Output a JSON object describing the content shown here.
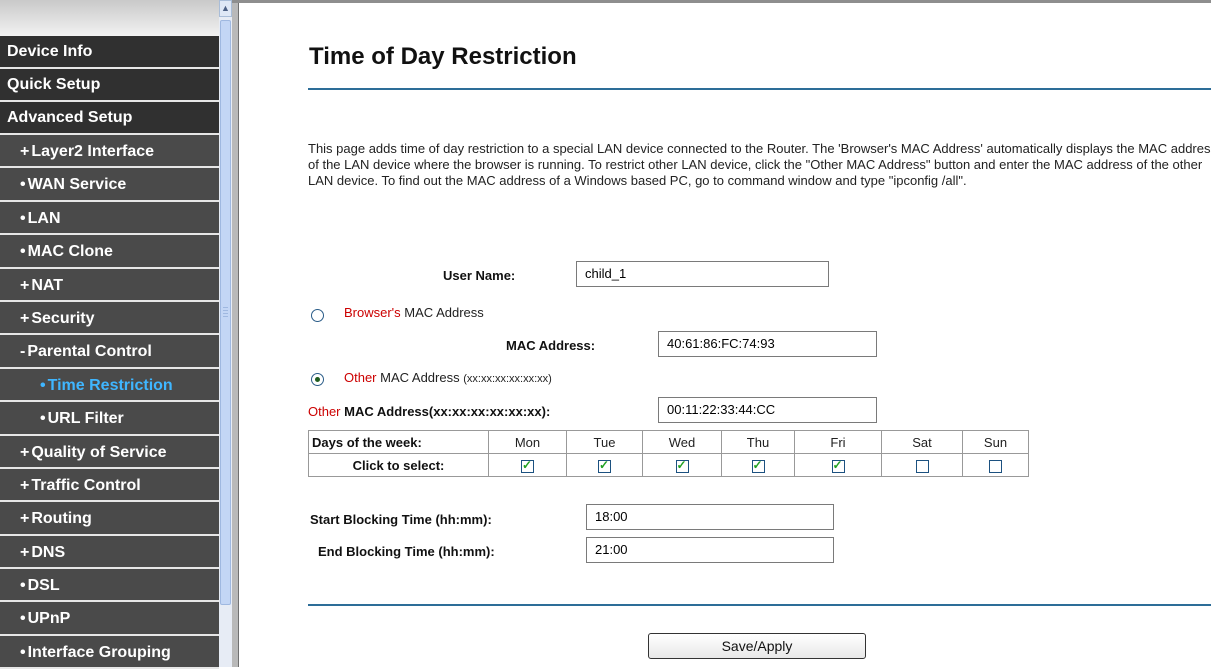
{
  "sidebar": {
    "items": [
      {
        "label": "Device Info",
        "level": 0,
        "marker": ""
      },
      {
        "label": "Quick Setup",
        "level": 0,
        "marker": ""
      },
      {
        "label": "Advanced Setup",
        "level": 0,
        "marker": ""
      },
      {
        "label": "Layer2 Interface",
        "level": 1,
        "marker": "+"
      },
      {
        "label": "WAN Service",
        "level": 1,
        "marker": "•"
      },
      {
        "label": "LAN",
        "level": 1,
        "marker": "•"
      },
      {
        "label": "MAC Clone",
        "level": 1,
        "marker": "•"
      },
      {
        "label": "NAT",
        "level": 1,
        "marker": "+"
      },
      {
        "label": "Security",
        "level": 1,
        "marker": "+"
      },
      {
        "label": "Parental Control",
        "level": 1,
        "marker": "-"
      },
      {
        "label": "Time Restriction",
        "level": 2,
        "marker": "•",
        "selected": true
      },
      {
        "label": "URL Filter",
        "level": 2,
        "marker": "•"
      },
      {
        "label": "Quality of Service",
        "level": 1,
        "marker": "+"
      },
      {
        "label": "Traffic Control",
        "level": 1,
        "marker": "+"
      },
      {
        "label": "Routing",
        "level": 1,
        "marker": "+"
      },
      {
        "label": "DNS",
        "level": 1,
        "marker": "+"
      },
      {
        "label": "DSL",
        "level": 1,
        "marker": "•"
      },
      {
        "label": "UPnP",
        "level": 1,
        "marker": "•"
      },
      {
        "label": "Interface Grouping",
        "level": 1,
        "marker": "•"
      }
    ]
  },
  "page": {
    "title": "Time of Day Restriction",
    "description": "This page adds time of day restriction to a special LAN device connected to the Router. The 'Browser's MAC Address' automatically displays the MAC address of the LAN device where the browser is running. To restrict other LAN device, click the \"Other MAC Address\" button and enter the MAC address of the other LAN device. To find out the MAC address of a Windows based PC, go to command window and type \"ipconfig /all\"."
  },
  "form": {
    "user_name_label": "User Name:",
    "user_name_value": "child_1",
    "browser_mac_red": "Browser's",
    "browser_mac_rest": " MAC Address",
    "mac_address_label": "MAC Address:",
    "mac_address_value": "40:61:86:FC:74:93",
    "other_mac_red": "Other",
    "other_mac_rest": " MAC Address ",
    "other_mac_hint": "(xx:xx:xx:xx:xx:xx)",
    "other_mac_field_red": "Other",
    "other_mac_field_rest": " MAC Address(xx:xx:xx:xx:xx:xx):",
    "other_mac_value": "00:11:22:33:44:CC",
    "selected_mode": "other",
    "days_label": "Days of the week:",
    "click_label": "Click to select:",
    "days": [
      {
        "name": "Mon",
        "checked": true
      },
      {
        "name": "Tue",
        "checked": true
      },
      {
        "name": "Wed",
        "checked": true
      },
      {
        "name": "Thu",
        "checked": true
      },
      {
        "name": "Fri",
        "checked": true
      },
      {
        "name": "Sat",
        "checked": false
      },
      {
        "name": "Sun",
        "checked": false
      }
    ],
    "start_label": "Start Blocking Time (hh:mm):",
    "start_value": "18:00",
    "end_label": "End Blocking Time (hh:mm):",
    "end_value": "21:00",
    "save_label": "Save/Apply"
  },
  "colors": {
    "menu_top": "#303030",
    "menu_sub": "#4a4a4a",
    "menu_selected_text": "#3fb6ff",
    "rule": "#2d6d98",
    "red_text": "#c00000"
  }
}
